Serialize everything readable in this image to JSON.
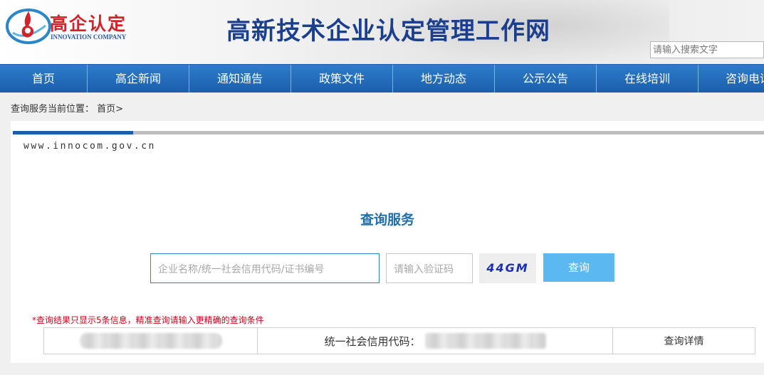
{
  "header": {
    "logo_cn": "高企认定",
    "logo_en": "INNOVATION COMPANY",
    "site_title": "高新技术企业认定管理工作网",
    "search_placeholder": "请输入搜索文字"
  },
  "nav": {
    "items": [
      "首页",
      "高企新闻",
      "通知通告",
      "政策文件",
      "地方动态",
      "公示公告",
      "在线培训",
      "咨询电话"
    ]
  },
  "breadcrumb": {
    "prefix": "查询服务当前位置：",
    "current": "首页",
    "separator": ">"
  },
  "content": {
    "progress": 0.16,
    "site_url": "www.innocom.gov.cn",
    "query_title": "查询服务",
    "query_placeholder": "企业名称/统一社会信用代码/证书编号",
    "captcha_placeholder": "请输入验证码",
    "captcha_code": "44GM",
    "query_button": "查询",
    "notice": "*查询结果只显示5条信息，精准查询请输入更精确的查询条件",
    "result": {
      "code_label": "统一社会信用代码：",
      "detail_label": "查询详情"
    }
  },
  "colors": {
    "nav_bg": "#1a5fae",
    "title": "#1b3f8f",
    "logo_red": "#d2232a",
    "button": "#5cb8f0",
    "notice": "#d0021b"
  }
}
